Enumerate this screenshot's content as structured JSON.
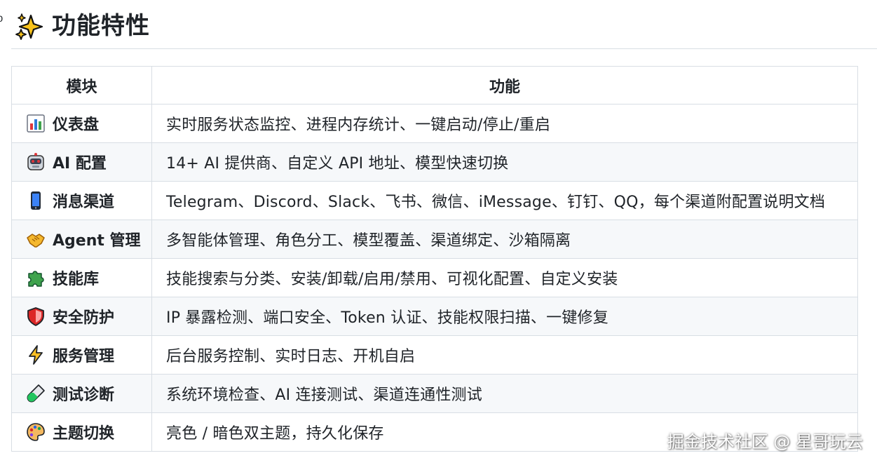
{
  "heading": {
    "anchor": "ͦ",
    "title": "功能特性",
    "icon": "sparkles-icon"
  },
  "table": {
    "headers": [
      "模块",
      "功能"
    ],
    "rows": [
      {
        "icon": "bar-chart-icon",
        "module": "仪表盘",
        "feature": "实时服务状态监控、进程内存统计、一键启动/停止/重启"
      },
      {
        "icon": "robot-icon",
        "module": "AI 配置",
        "feature": "14+ AI 提供商、自定义 API 地址、模型快速切换"
      },
      {
        "icon": "mobile-phone-icon",
        "module": "消息渠道",
        "feature": "Telegram、Discord、Slack、飞书、微信、iMessage、钉钉、QQ，每个渠道附配置说明文档"
      },
      {
        "icon": "handshake-icon",
        "module": "Agent 管理",
        "feature": "多智能体管理、角色分工、模型覆盖、渠道绑定、沙箱隔离"
      },
      {
        "icon": "puzzle-piece-icon",
        "module": "技能库",
        "feature": "技能搜索与分类、安装/卸载/启用/禁用、可视化配置、自定义安装"
      },
      {
        "icon": "shield-icon",
        "module": "安全防护",
        "feature": "IP 暴露检测、端口安全、Token 认证、技能权限扫描、一键修复"
      },
      {
        "icon": "lightning-icon",
        "module": "服务管理",
        "feature": "后台服务控制、实时日志、开机自启"
      },
      {
        "icon": "test-tube-icon",
        "module": "测试诊断",
        "feature": "系统环境检查、AI 连接测试、渠道连通性测试"
      },
      {
        "icon": "palette-icon",
        "module": "主题切换",
        "feature": "亮色 / 暗色双主题，持久化保存"
      }
    ]
  },
  "watermark": "掘金技术社区 @ 星哥玩云"
}
